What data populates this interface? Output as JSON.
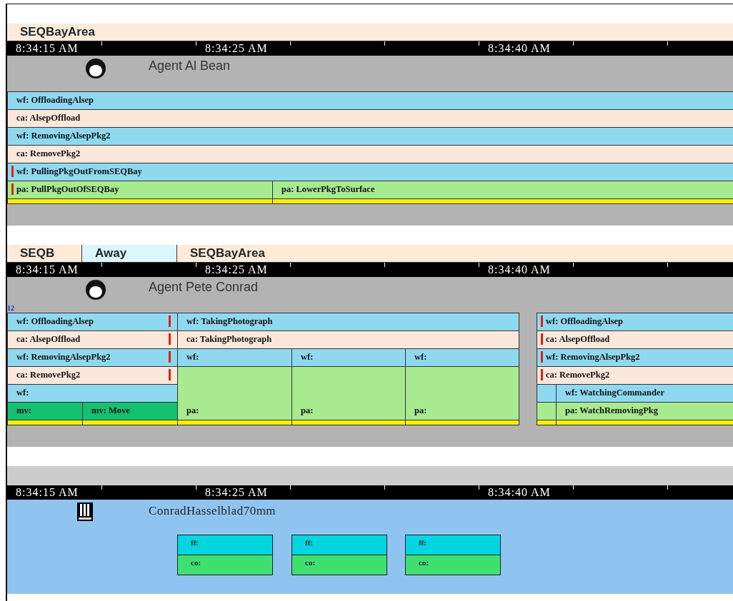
{
  "panels": [
    {
      "kind": "agent",
      "header": [
        {
          "label": "SEQBayArea",
          "selected": false
        }
      ],
      "timeline": [
        "8:34:15 AM",
        "8:34:25 AM",
        "8:34:40 AM"
      ],
      "name": "Agent Al Bean",
      "blocks": [
        {
          "kind": "wf",
          "label": "wf: OffloadingAlsep",
          "marked": false
        },
        {
          "kind": "ca",
          "label": "ca: AlsepOffload",
          "marked": false
        },
        {
          "kind": "wf",
          "label": "wf: RemovingAlsepPkg2",
          "marked": false
        },
        {
          "kind": "ca",
          "label": "ca: RemovePkg2",
          "marked": false
        },
        {
          "kind": "wf",
          "label": "wf: PullingPkgOutFromSEQBay",
          "marked": true
        },
        {
          "kind": "pa",
          "label": "pa: PullPkgOutOfSEQBay",
          "marked": true
        },
        {
          "kind": "pa",
          "label": "pa: LowerPkgToSurface",
          "marked": false
        }
      ]
    },
    {
      "kind": "agent",
      "header": [
        {
          "label": "SEQB",
          "selected": false
        },
        {
          "label": "Away",
          "selected": true
        },
        {
          "label": "SEQBayArea",
          "selected": false
        }
      ],
      "timeline": [
        "8:34:15 AM",
        "8:34:25 AM",
        "8:34:40 AM"
      ],
      "name": "Agent Pete Conrad",
      "lane_count": "12",
      "blocks": [
        {
          "kind": "wf",
          "label": "wf: OffloadingAlsep",
          "marked": true
        },
        {
          "kind": "wf",
          "label": "wf: TakingPhotograph",
          "marked": false
        },
        {
          "kind": "wf",
          "label": "wf: OffloadingAlsep",
          "marked": true
        },
        {
          "kind": "ca",
          "label": "ca: AlsepOffload",
          "marked": true
        },
        {
          "kind": "ca",
          "label": "ca: TakingPhotograph",
          "marked": false
        },
        {
          "kind": "ca",
          "label": "ca: AlsepOffload",
          "marked": true
        },
        {
          "kind": "wf",
          "label": "wf: RemovingAlsepPkg2",
          "marked": true
        },
        {
          "kind": "wf",
          "label": "wf:",
          "marked": false
        },
        {
          "kind": "wf",
          "label": "wf:",
          "marked": false
        },
        {
          "kind": "wf",
          "label": "wf:",
          "marked": false
        },
        {
          "kind": "wf",
          "label": "wf: RemovingAlsepPkg2",
          "marked": true
        },
        {
          "kind": "ca",
          "label": "ca: RemovePkg2",
          "marked": true
        },
        {
          "kind": "pa",
          "label": "pa:",
          "marked": false
        },
        {
          "kind": "pa",
          "label": "pa:",
          "marked": false
        },
        {
          "kind": "pa",
          "label": "pa:",
          "marked": false
        },
        {
          "kind": "ca",
          "label": "ca: RemovePkg2",
          "marked": true
        },
        {
          "kind": "wf",
          "label": "wf:",
          "marked": false
        },
        {
          "kind": "wf",
          "marked": false
        },
        {
          "kind": "wf",
          "label": "wf: WatchingCommander",
          "marked": false
        },
        {
          "kind": "mv",
          "label": "mv:",
          "marked": false
        },
        {
          "kind": "mv",
          "label": "mv: Move",
          "marked": false
        },
        {
          "kind": "pa",
          "marked": false
        },
        {
          "kind": "pa",
          "label": "pa: WatchRemovingPkg",
          "marked": false
        }
      ]
    },
    {
      "kind": "object",
      "timeline": [
        "8:34:15 AM",
        "8:34:25 AM",
        "8:34:40 AM"
      ],
      "name": "ConradHasselblad70mm",
      "boxes": [
        {
          "top": "ff:",
          "bottom": "co:"
        },
        {
          "top": "ff:",
          "bottom": "co:"
        },
        {
          "top": "ff:",
          "bottom": "co:"
        }
      ]
    }
  ]
}
